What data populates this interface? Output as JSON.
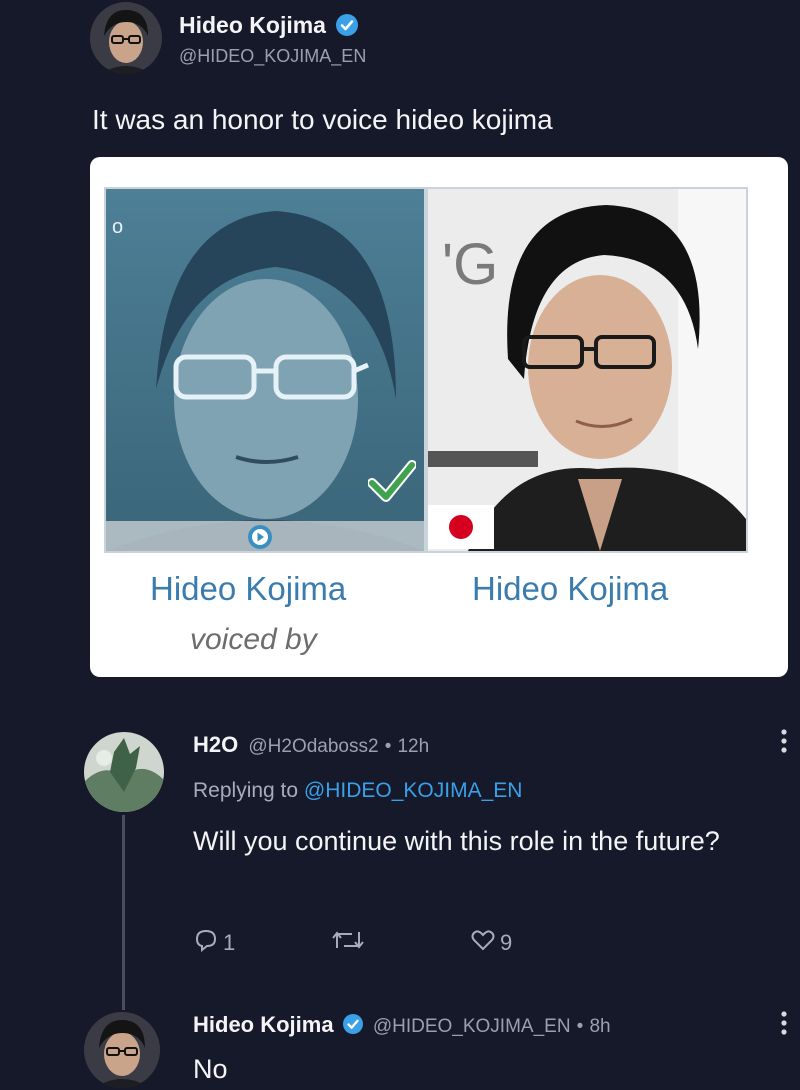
{
  "tweet": {
    "author_name": "Hideo Kojima",
    "author_handle": "@HIDEO_KOJIMA_EN",
    "text": "It was an honor to voice hideo kojima"
  },
  "card": {
    "left_label": "Hideo Kojima",
    "right_label": "Hideo Kojima",
    "subtitle": "voiced by",
    "backdrop_letters": "'G",
    "left_corner_mark": "o"
  },
  "reply": {
    "author_name": "H2O",
    "author_handle": "@H2Odaboss2",
    "separator": "•",
    "time": "12h",
    "replying_prefix": "Replying to",
    "replying_to": "@HIDEO_KOJIMA_EN",
    "text": "Will you continue with this role in the future?",
    "reply_count": "1",
    "like_count": "9"
  },
  "second_reply": {
    "author_name": "Hideo Kojima",
    "author_handle": "@HIDEO_KOJIMA_EN",
    "separator": "•",
    "time": "8h",
    "text": "No"
  },
  "colors": {
    "background": "#16192a",
    "verified": "#3aa0e8",
    "link": "#3aa0e8",
    "card_label": "#3a7cae",
    "check": "#3fa34d"
  },
  "icons": [
    "verified-icon",
    "reply-icon",
    "retweet-icon",
    "like-icon",
    "more-icon",
    "play-icon",
    "checkmark-icon",
    "japan-flag-icon"
  ]
}
